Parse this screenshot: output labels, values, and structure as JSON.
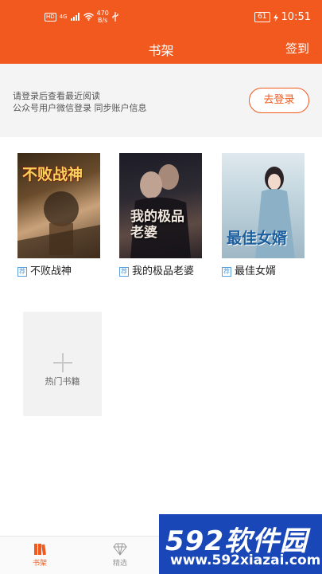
{
  "status_bar": {
    "hd": "HD",
    "network": "4G",
    "speed_value": "470",
    "speed_unit": "B/s",
    "battery": "61",
    "time": "10:51"
  },
  "header": {
    "title": "书架",
    "signin_label": "签到"
  },
  "login_prompt": {
    "line1": "请登录后查看最近阅读",
    "line2": "公众号用户微信登录 同步账户信息",
    "button_label": "去登录"
  },
  "books": [
    {
      "badge": "荐",
      "name": "不败战神",
      "cover_title": "不败战神"
    },
    {
      "badge": "荐",
      "name": "我的极品老婆",
      "cover_title": "我的极品老婆"
    },
    {
      "badge": "荐",
      "name": "最佳女婿",
      "cover_title": "最佳女婿"
    }
  ],
  "hot_books": {
    "label": "热门书籍"
  },
  "bottom_nav": [
    {
      "label": "书架",
      "icon": "bookshelf-icon",
      "active": true
    },
    {
      "label": "精选",
      "icon": "diamond-icon",
      "active": false
    }
  ],
  "watermark": {
    "logo": "592软件园",
    "url": "www.592xiazai.com"
  },
  "colors": {
    "accent": "#f2591e",
    "badge": "#58a1de"
  }
}
